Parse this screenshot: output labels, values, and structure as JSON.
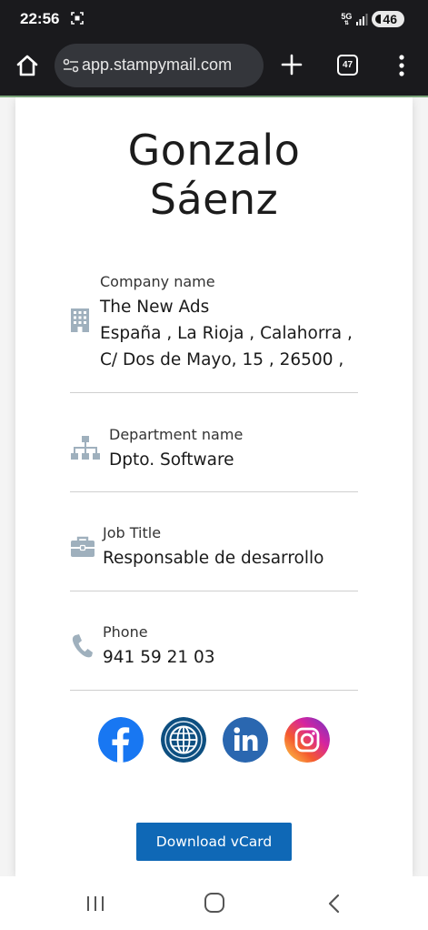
{
  "status_bar": {
    "time": "22:56",
    "network": "5G",
    "battery": "46",
    "icons": [
      "screenshot-icon",
      "signal-icon",
      "battery-icon"
    ]
  },
  "browser": {
    "url": "app.stampymail.com",
    "tab_count": "47",
    "icons": [
      "home-icon",
      "tune-icon",
      "plus-icon",
      "tabs-icon",
      "more-vert-icon"
    ]
  },
  "profile": {
    "first_name": "Gonzalo",
    "last_name": "Sáenz"
  },
  "company": {
    "label": "Company name",
    "name": "The New Ads",
    "address_line1": "España , La Rioja , Calahorra ,",
    "address_line2": "C/ Dos de Mayo, 15 , 26500 ,",
    "icon": "building-icon"
  },
  "department": {
    "label": "Department name",
    "value": "Dpto. Software",
    "icon": "sitemap-icon"
  },
  "job": {
    "label": "Job Title",
    "value": "Responsable de desarrollo",
    "icon": "briefcase-icon"
  },
  "phone": {
    "label": "Phone",
    "value": "941 59 21 03",
    "icon": "phone-icon"
  },
  "social_links": [
    {
      "name": "facebook",
      "icon": "facebook-icon",
      "color": "#1877f2"
    },
    {
      "name": "website",
      "icon": "globe-icon",
      "color": "#0d4f80"
    },
    {
      "name": "linkedin",
      "icon": "linkedin-icon",
      "color": "#2a67b0"
    },
    {
      "name": "instagram",
      "icon": "instagram-icon",
      "color": "#d6249f"
    }
  ],
  "actions": {
    "download_vcard": "Download vCard"
  },
  "colors": {
    "accent": "#0f68b6",
    "icon_gray": "#9fb0bd",
    "chrome_dark": "#1a1a1d"
  }
}
